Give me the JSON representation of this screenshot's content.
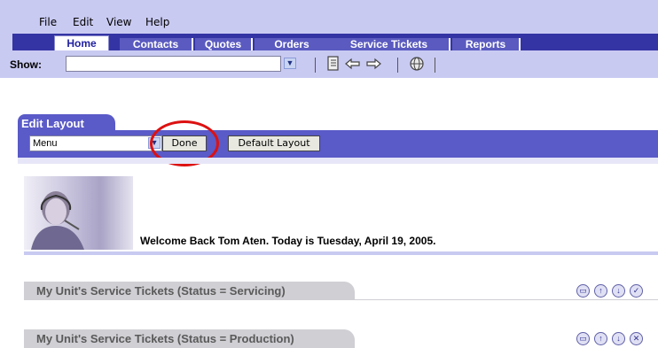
{
  "menu": {
    "items": [
      "File",
      "Edit",
      "View",
      "Help"
    ]
  },
  "tabs": [
    {
      "label": "Home",
      "active": true
    },
    {
      "label": "Contacts"
    },
    {
      "label": "Quotes"
    },
    {
      "label": "Orders"
    },
    {
      "label": "Service Tickets"
    },
    {
      "label": "Reports"
    }
  ],
  "show": {
    "label": "Show:",
    "value": "",
    "icons": [
      "document-icon",
      "back-arrow-icon",
      "forward-arrow-icon",
      "globe-icon"
    ]
  },
  "edit_layout": {
    "title": "Edit Layout",
    "select_value": "Menu",
    "done_label": "Done",
    "default_label": "Default Layout"
  },
  "welcome": {
    "text": "Welcome Back Tom Aten.  Today is Tuesday, April 19, 2005."
  },
  "panels": [
    {
      "title": "My Unit's Service Tickets (Status = Servicing)"
    },
    {
      "title": "My Unit's Service Tickets (Status = Production)"
    }
  ],
  "colors": {
    "accent": "#3434a4",
    "bar": "#c9caf2",
    "edit_bar": "#5a5ac8",
    "highlight_circle": "#dd1111"
  }
}
